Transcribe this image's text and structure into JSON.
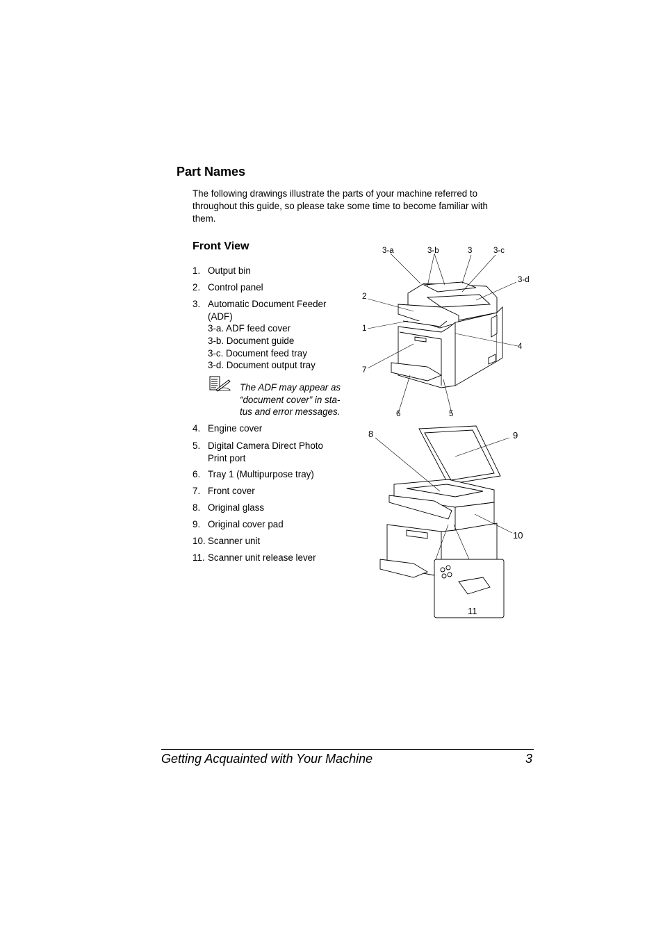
{
  "section": {
    "title": "Part Names",
    "intro_lines": [
      "The following drawings illustrate the parts of your machine referred to",
      "throughout this guide, so please take some time to become familiar with",
      "them."
    ]
  },
  "front_view": {
    "title": "Front View",
    "items": [
      {
        "num": "1.",
        "text": "Output bin"
      },
      {
        "num": "2.",
        "text": "Control panel"
      },
      {
        "num": "3.",
        "text": "Automatic Document Feeder (ADF)"
      },
      {
        "num": "4.",
        "text": "Engine cover"
      },
      {
        "num": "5.",
        "text": "Digital Camera Direct Photo Print port"
      },
      {
        "num": "6.",
        "text": "Tray 1 (Multipurpose tray)"
      },
      {
        "num": "7.",
        "text": "Front cover"
      },
      {
        "num": "8.",
        "text": "Original glass"
      },
      {
        "num": "9.",
        "text": "Original cover pad"
      },
      {
        "num": "10.",
        "text": "Scanner unit"
      },
      {
        "num": "11.",
        "text": "Scanner unit release lever"
      }
    ],
    "sub_items": [
      "3-a. ADF feed cover",
      "3-b. Document guide",
      "3-c. Document feed tray",
      "3-d. Document output tray"
    ],
    "note": {
      "icon": "note-pencil-icon",
      "lines": [
        "The ADF may appear as",
        "“document cover” in sta-",
        "tus and error messages."
      ]
    }
  },
  "figure1": {
    "callouts": [
      "3-a",
      "3-b",
      "3",
      "3-c",
      "3-d",
      "2",
      "1",
      "4",
      "7",
      "6",
      "5"
    ]
  },
  "figure2": {
    "callouts": [
      "8",
      "9",
      "10",
      "11"
    ]
  },
  "footer": {
    "title": "Getting Acquainted with Your Machine",
    "page": "3"
  }
}
